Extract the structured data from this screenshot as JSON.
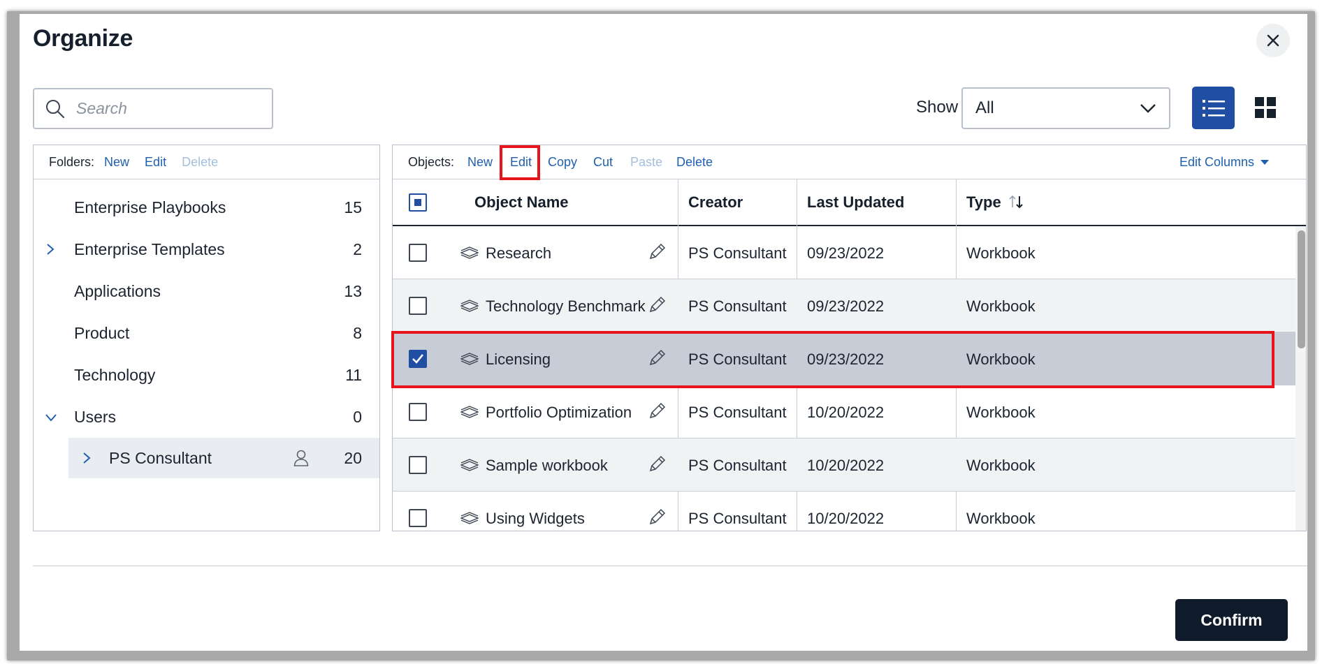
{
  "dialog": {
    "title": "Organize"
  },
  "search": {
    "placeholder": "Search"
  },
  "show": {
    "label": "Show",
    "selected": "All"
  },
  "folders": {
    "toolbar": {
      "label": "Folders:",
      "new": "New",
      "edit": "Edit",
      "delete": "Delete"
    },
    "items": [
      {
        "name": "Enterprise Playbooks",
        "count": "15"
      },
      {
        "name": "Enterprise Templates",
        "count": "2"
      },
      {
        "name": "Applications",
        "count": "13"
      },
      {
        "name": "Product",
        "count": "8"
      },
      {
        "name": "Technology",
        "count": "11"
      },
      {
        "name": "Users",
        "count": "0"
      },
      {
        "name": "PS Consultant",
        "count": "20"
      }
    ]
  },
  "objects": {
    "toolbar": {
      "label": "Objects:",
      "new": "New",
      "edit": "Edit",
      "copy": "Copy",
      "cut": "Cut",
      "paste": "Paste",
      "delete": "Delete",
      "edit_columns": "Edit Columns"
    },
    "columns": {
      "name": "Object Name",
      "creator": "Creator",
      "updated": "Last Updated",
      "type": "Type"
    },
    "rows": [
      {
        "name": "Research",
        "creator": "PS Consultant",
        "updated": "09/23/2022",
        "type": "Workbook"
      },
      {
        "name": "Technology Benchmark",
        "creator": "PS Consultant",
        "updated": "09/23/2022",
        "type": "Workbook"
      },
      {
        "name": "Licensing",
        "creator": "PS Consultant",
        "updated": "09/23/2022",
        "type": "Workbook"
      },
      {
        "name": "Portfolio Optimization",
        "creator": "PS Consultant",
        "updated": "10/20/2022",
        "type": "Workbook"
      },
      {
        "name": "Sample workbook",
        "creator": "PS Consultant",
        "updated": "10/20/2022",
        "type": "Workbook"
      },
      {
        "name": "Using Widgets",
        "creator": "PS Consultant",
        "updated": "10/20/2022",
        "type": "Workbook"
      }
    ]
  },
  "footer": {
    "confirm": "Confirm"
  },
  "colors": {
    "accent": "#1f4ea3",
    "link": "#1f5fb0",
    "highlight": "#e8141b",
    "confirm_bg": "#0f1a2a"
  }
}
